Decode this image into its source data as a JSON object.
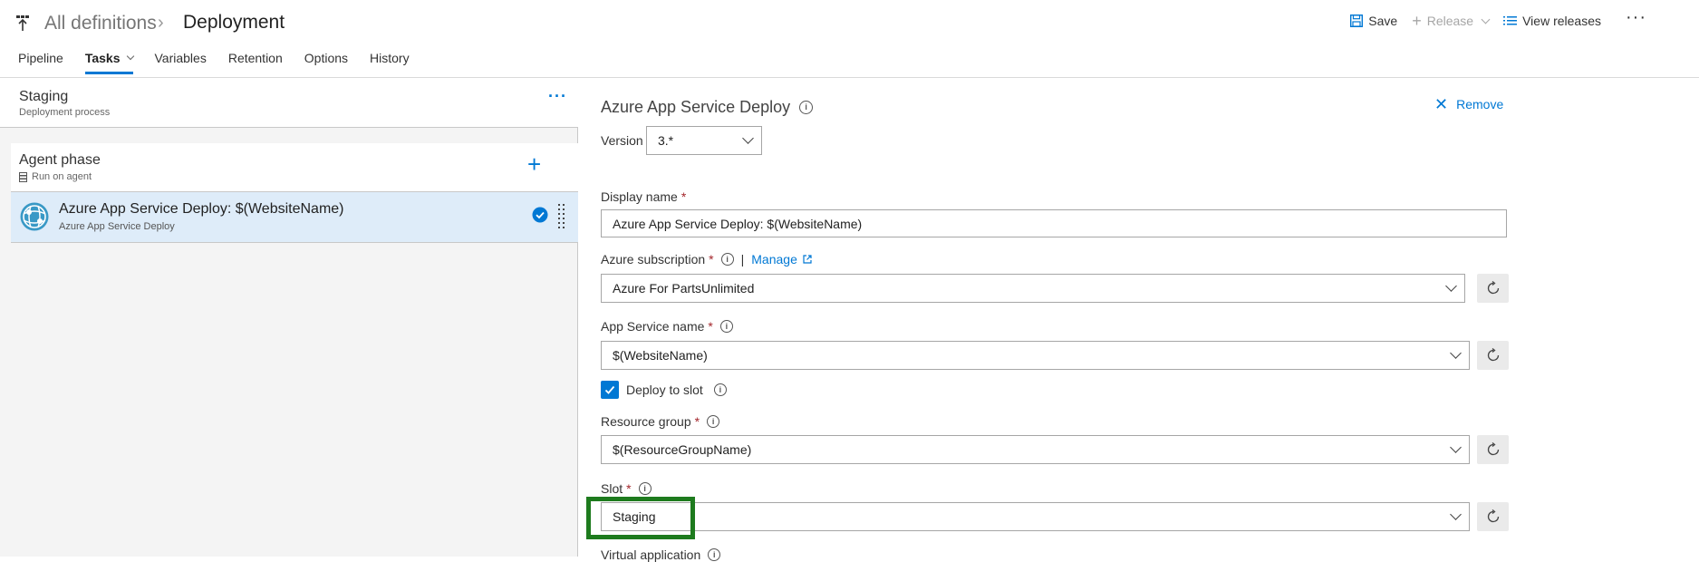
{
  "header": {
    "breadcrumb_root": "All definitions",
    "breadcrumb_current": "Deployment",
    "save_label": "Save",
    "release_label": "Release",
    "view_releases_label": "View releases",
    "more_label": "···"
  },
  "tabs": [
    {
      "label": "Pipeline"
    },
    {
      "label": "Tasks"
    },
    {
      "label": "Variables"
    },
    {
      "label": "Retention"
    },
    {
      "label": "Options"
    },
    {
      "label": "History"
    }
  ],
  "stage": {
    "title": "Staging",
    "subtitle": "Deployment process",
    "more_label": "···"
  },
  "phase": {
    "title": "Agent phase",
    "subtitle": "Run on agent",
    "add_label": "+"
  },
  "task": {
    "title": "Azure App Service Deploy: $(WebsiteName)",
    "subtitle": "Azure App Service Deploy"
  },
  "details": {
    "task_name": "Azure App Service Deploy",
    "remove_label": "Remove",
    "version_label": "Version",
    "version_value": "3.*",
    "display_name_label": "Display name",
    "display_name_value": "Azure App Service Deploy: $(WebsiteName)",
    "subscription_label": "Azure subscription",
    "manage_label": "Manage",
    "subscription_value": "Azure For PartsUnlimited",
    "app_service_label": "App Service name",
    "app_service_value": "$(WebsiteName)",
    "deploy_to_slot_label": "Deploy to slot",
    "resource_group_label": "Resource group",
    "resource_group_value": "$(ResourceGroupName)",
    "slot_label": "Slot",
    "slot_value": "Staging",
    "virtual_app_label": "Virtual application",
    "required_mark": "*",
    "info_glyph": "i",
    "pipe_sep": "|"
  },
  "colors": {
    "accent": "#0078d4",
    "selected_task_bg": "#deecf9",
    "highlight_box": "#1e7b1e",
    "required": "#a4262c"
  }
}
